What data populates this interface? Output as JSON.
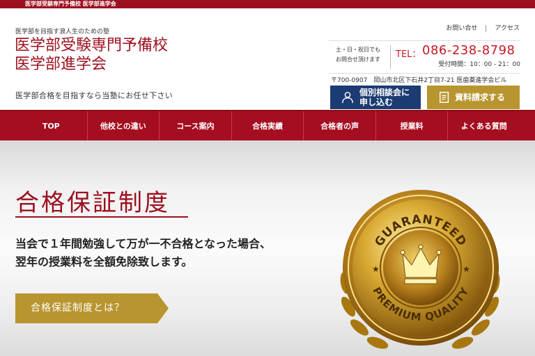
{
  "topbar": {
    "text": "医学部受験専門予備校 医学部進学会"
  },
  "header": {
    "tagline": "医学部を目指す浪人生のための塾",
    "logo_line1": "医学部受験専門予備校",
    "logo_line2": "医学部進学会",
    "subcopy": "医学部合格を目指すなら当塾にお任せ下さい"
  },
  "util_links": {
    "contact": "お問い合せ",
    "access": "アクセス"
  },
  "contact": {
    "hours_line1": "土・日・祝日でも",
    "hours_line2": "お問合せ頂けます",
    "tel_label": "TEL：",
    "tel_number": "086-238-8798",
    "reception": "受付時間：10：00 - 21：00",
    "address": "〒700-0907　岡山市北区下石井2丁目7-21 医歯薬進学会ビル"
  },
  "buttons": {
    "consult_line1": "個別相談会に",
    "consult_line2": "申し込む",
    "docs": "資料請求する"
  },
  "nav": [
    "TOP",
    "他校との違い",
    "コース案内",
    "合格実績",
    "合格者の声",
    "授業料",
    "よくある質問"
  ],
  "hero": {
    "title": "合格保証制度",
    "body_line1": "当会で１年間勉強して万が一不合格となった場合、",
    "body_line2": "翌年の授業料を全額免除致します。",
    "cta": "合格保証制度とは？"
  },
  "badge": {
    "top_text": "GUARANTEED",
    "bottom_text": "PREMIUM QUALITY"
  },
  "colors": {
    "brand_red": "#9c0f1e",
    "nav_red": "#a50e20",
    "navy": "#1c3b73",
    "gold": "#b8952f"
  }
}
